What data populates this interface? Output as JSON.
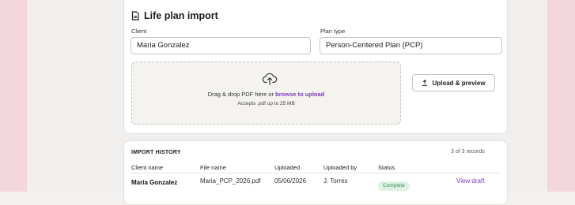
{
  "import_card": {
    "title": "Life plan import",
    "client_label": "Client",
    "client_value": "Maria Gonzalez",
    "plan_type_label": "Plan type",
    "plan_type_value": "Person-Centered Plan (PCP)",
    "dropzone": {
      "text_before_link": "Drag & drop PDF here or ",
      "link_text": "browse to upload",
      "subtext": "Accepts .pdf up to 25 MB"
    },
    "upload_button_label": "Upload & preview",
    "more_label": "···"
  },
  "history": {
    "title": "IMPORT HISTORY",
    "count": "3 of 3 records",
    "columns": [
      "Client name",
      "File name",
      "Uploaded",
      "Uploaded by",
      "Status"
    ],
    "rows": [
      {
        "client": "Maria Gonzalez",
        "file": "Maria_PCP_2026.pdf",
        "uploaded": "05/06/2026",
        "by": "J. Torres",
        "status": "Complete",
        "action": "View draft"
      }
    ]
  },
  "colors": {
    "accent": "#7a3fc0",
    "side_stripe": "#f3d6de",
    "status_complete_bg": "#dcf3e4",
    "status_complete_text": "#3a8a56"
  },
  "icons": {
    "title": "document-icon",
    "dropzone": "cloud-upload-icon",
    "upload_button": "upload-icon",
    "more": "more-horizontal-icon"
  }
}
